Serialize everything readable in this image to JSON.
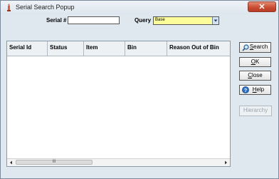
{
  "window": {
    "title": "Serial Search Popup"
  },
  "form": {
    "serial_label": "Serial #",
    "serial_value": "",
    "query_label": "Query",
    "query_value": "Base"
  },
  "grid": {
    "columns": [
      "Serial Id",
      "Status",
      "Item",
      "Bin",
      "Reason Out of Bin"
    ],
    "rows": [],
    "scroll_thumb_label": "III"
  },
  "buttons": {
    "search": {
      "pre": "",
      "hot": "S",
      "post": "earch"
    },
    "ok": {
      "pre": "",
      "hot": "O",
      "post": "K"
    },
    "close": {
      "pre": "",
      "hot": "C",
      "post": "lose"
    },
    "help": {
      "pre": "",
      "hot": "H",
      "post": "elp"
    },
    "hierarchy": "Hierarchy"
  },
  "colors": {
    "query_field_bg": "#fcfc9a",
    "close_button": "#c94f34",
    "window_bg": "#dfe8ef"
  },
  "icons": [
    "app-icon",
    "close-icon",
    "search-icon",
    "help-icon",
    "dropdown-arrow-icon",
    "scroll-left-icon",
    "scroll-right-icon"
  ]
}
